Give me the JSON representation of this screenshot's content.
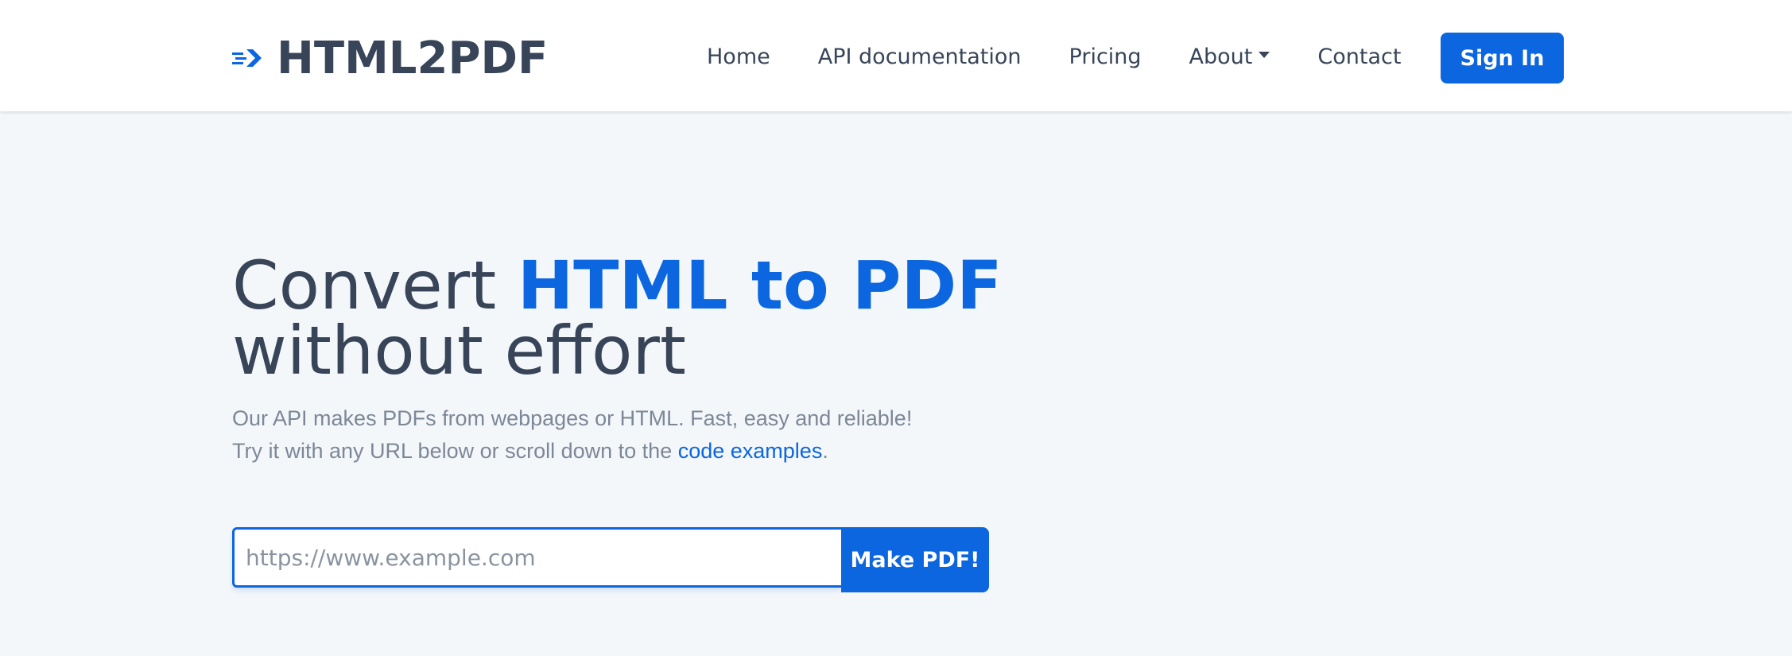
{
  "header": {
    "brand": "HTML2PDF",
    "nav": [
      {
        "label": "Home"
      },
      {
        "label": "API documentation"
      },
      {
        "label": "Pricing"
      },
      {
        "label": "About"
      },
      {
        "label": "Contact"
      }
    ],
    "signin_label": "Sign In"
  },
  "hero": {
    "title_plain": "Convert ",
    "title_accent": "HTML to PDF",
    "title_line2": "without effort",
    "text_line1": "Our API makes PDFs from webpages or HTML. Fast, easy and reliable!",
    "text_line2_before": "Try it with any URL below or scroll down to the ",
    "text_link": "code examples",
    "text_after": "."
  },
  "form": {
    "placeholder": "https://www.example.com",
    "value": "",
    "button_label": "Make PDF!"
  },
  "colors": {
    "accent": "#0b66df",
    "text_dark": "#384559",
    "text_muted": "#7c8797",
    "background": "#f4f7fa"
  },
  "icons": {
    "brand_logo": "speed-arrow-icon",
    "about_caret": "caret-down-icon"
  }
}
